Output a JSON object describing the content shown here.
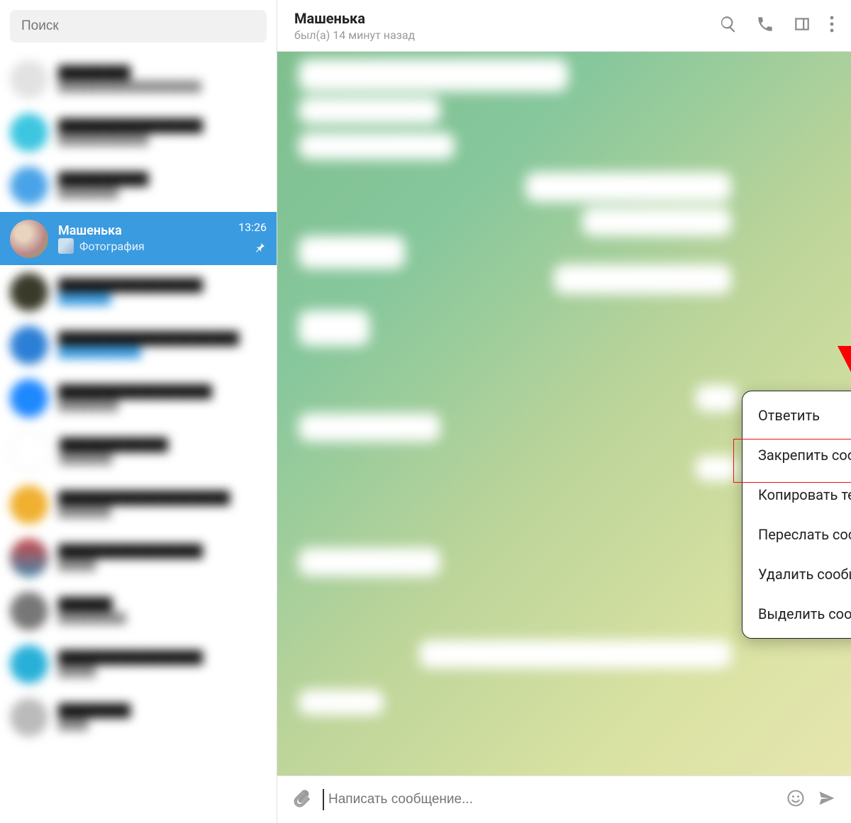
{
  "sidebar": {
    "search_placeholder": "Поиск"
  },
  "selected_chat": {
    "name": "Машенька",
    "time": "13:26",
    "preview_label": "Фотография"
  },
  "header": {
    "name": "Машенька",
    "status": "был(а) 14 минут назад"
  },
  "context_menu": {
    "items": [
      "Ответить",
      "Закрепить сообщение",
      "Копировать текст",
      "Переслать сообщение",
      "Удалить сообщение",
      "Выделить сообщение"
    ],
    "highlighted_index": 1
  },
  "composer": {
    "placeholder": "Написать сообщение..."
  },
  "annotation": {
    "arrow_color": "#ff0000",
    "highlight_color": "#ee1111"
  }
}
